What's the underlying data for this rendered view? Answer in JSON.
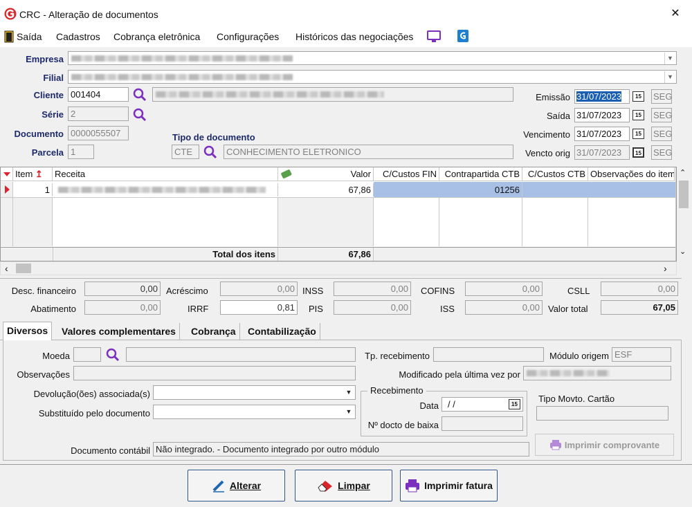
{
  "window": {
    "title": "CRC - Alteração de documentos",
    "close_glyph": "✕",
    "app_icon": "app-logo-icon"
  },
  "menu": {
    "items": [
      "Saída",
      "Cadastros",
      "Cobrança eletrônica",
      "Configurações",
      "Históricos das negociações"
    ]
  },
  "header": {
    "empresa_label": "Empresa",
    "filial_label": "Filial",
    "cliente_label": "Cliente",
    "cliente_code": "001404",
    "serie_label": "Série",
    "serie_value": "2",
    "documento_label": "Documento",
    "documento_value": "0000055507",
    "parcela_label": "Parcela",
    "parcela_value": "1",
    "tipo_label": "Tipo de documento",
    "tipo_code": "CTE",
    "tipo_desc": "CONHECIMENTO ELETRONICO",
    "emissao_label": "Emissão",
    "emissao_value": "31/07/2023",
    "emissao_dow": "SEG",
    "saida_label": "Saída",
    "saida_value": "31/07/2023",
    "saida_dow": "SEG",
    "vencimento_label": "Vencimento",
    "vencimento_value": "31/07/2023",
    "vencimento_dow": "SEG",
    "vencto_orig_label": "Vencto orig",
    "vencto_orig_value": "31/07/2023",
    "vencto_orig_dow": "SEG",
    "cal_glyph": "15"
  },
  "grid": {
    "columns": [
      "Item",
      "Receita",
      "Valor",
      "C/Custos FIN",
      "Contrapartida CTB",
      "C/Custos CTB",
      "Observações do item"
    ],
    "rows": [
      {
        "item": "1",
        "valor": "67,86",
        "contrapartida": "01256"
      }
    ],
    "total_label": "Total dos itens",
    "total_value": "67,86"
  },
  "totals": {
    "desc_fin_label": "Desc. financeiro",
    "desc_fin": "0,00",
    "acrescimo_label": "Acréscimo",
    "acrescimo": "0,00",
    "inss_label": "INSS",
    "inss": "0,00",
    "cofins_label": "COFINS",
    "cofins": "0,00",
    "csll_label": "CSLL",
    "csll": "0,00",
    "abatimento_label": "Abatimento",
    "abatimento": "0,00",
    "irrf_label": "IRRF",
    "irrf": "0,81",
    "pis_label": "PIS",
    "pis": "0,00",
    "iss_label": "ISS",
    "iss": "0,00",
    "valor_total_label": "Valor total",
    "valor_total": "67,05"
  },
  "tabs": [
    "Diversos",
    "Valores complementares",
    "Cobrança",
    "Contabilização"
  ],
  "diversos": {
    "moeda_label": "Moeda",
    "observacoes_label": "Observações",
    "devolucao_label": "Devolução(ões) associada(s)",
    "substituido_label": "Substituído pelo documento",
    "tp_recebimento_label": "Tp. recebimento",
    "modulo_origem_label": "Módulo origem",
    "modulo_origem_value": "ESF",
    "modificado_label": "Modificado pela última vez por",
    "recebimento_group": "Recebimento",
    "data_label": "Data",
    "data_value": "/ /",
    "docto_baixa_label": "Nº docto de baixa",
    "tipo_movto_label": "Tipo Movto. Cartão",
    "imprimir_comprovante_label": "Imprimir comprovante",
    "doc_contabil_label": "Documento contábil",
    "doc_contabil_value": "Não integrado.  - Documento integrado por outro módulo"
  },
  "buttons": {
    "alterar": "Alterar",
    "limpar": "Limpar",
    "imprimir_fatura": "Imprimir fatura"
  },
  "colors": {
    "accent": "#7b2fbe",
    "selected_bg": "#a8bfe6",
    "date_highlight": "#1a5fb4",
    "label_blue": "#1c2a6b"
  }
}
